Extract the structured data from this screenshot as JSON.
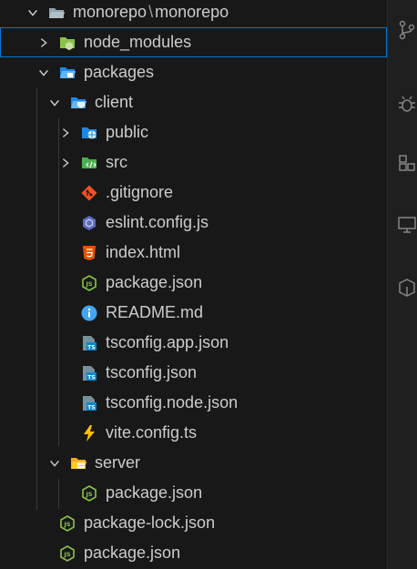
{
  "tree": {
    "root": "monorepo",
    "root_sub": "monorepo",
    "items": [
      {
        "label": "node_modules"
      },
      {
        "label": "packages"
      },
      {
        "label": "client"
      },
      {
        "label": "public"
      },
      {
        "label": "src"
      },
      {
        "label": ".gitignore"
      },
      {
        "label": "eslint.config.js"
      },
      {
        "label": "index.html"
      },
      {
        "label": "package.json"
      },
      {
        "label": "README.md"
      },
      {
        "label": "tsconfig.app.json"
      },
      {
        "label": "tsconfig.json"
      },
      {
        "label": "tsconfig.node.json"
      },
      {
        "label": "vite.config.ts"
      },
      {
        "label": "server"
      },
      {
        "label": "package.json"
      },
      {
        "label": "package-lock.json"
      },
      {
        "label": "package.json"
      }
    ]
  },
  "colors": {
    "selection_border": "#0078d4",
    "folder_green": "#8bc34a",
    "folder_blue": "#42a5f5",
    "folder_yellow": "#ffca28",
    "git_orange": "#f4511e",
    "html_orange": "#e65100",
    "js_green": "#8bc34a",
    "info_blue": "#42a5f5",
    "ts_blue": "#0288d1",
    "vite_yellow": "#ffc107"
  },
  "icons": [
    "folder-open-icon",
    "node-folder-icon",
    "packages-folder-icon",
    "client-folder-icon",
    "public-folder-icon",
    "src-folder-icon",
    "git-icon",
    "eslint-icon",
    "html-icon",
    "js-json-icon",
    "info-icon",
    "ts-config-icon",
    "vite-icon",
    "server-folder-icon",
    "source-control-icon",
    "debug-icon",
    "extensions-icon",
    "remote-icon",
    "testing-icon"
  ]
}
